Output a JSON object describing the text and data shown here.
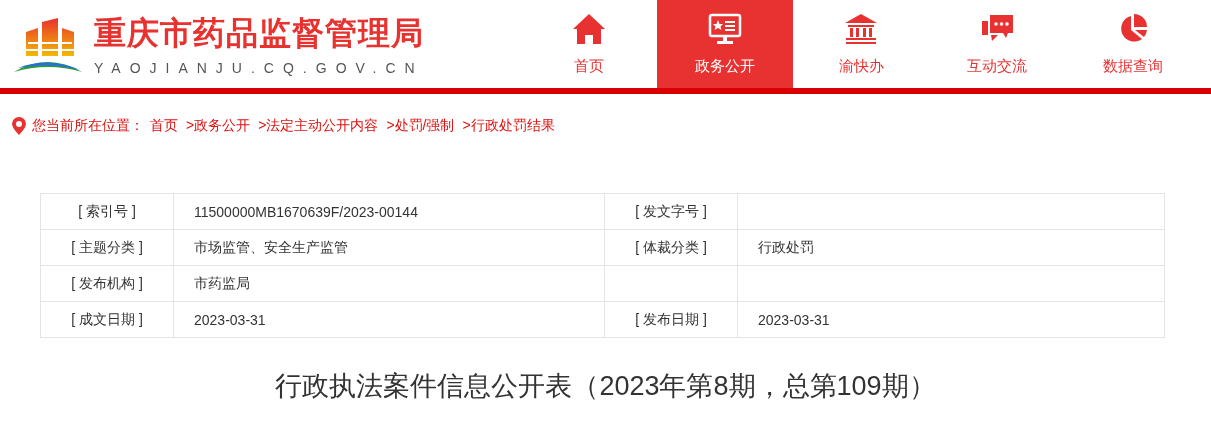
{
  "site": {
    "title": "重庆市药品监督管理局",
    "domain": "YAOJIANJU.CQ.GOV.CN"
  },
  "nav": [
    {
      "label": "首页",
      "kind": "home",
      "selected": false
    },
    {
      "label": "政务公开",
      "kind": "screen",
      "selected": true
    },
    {
      "label": "渝快办",
      "kind": "bank",
      "selected": false
    },
    {
      "label": "互动交流",
      "kind": "chat",
      "selected": false
    },
    {
      "label": "数据查询",
      "kind": "pie",
      "selected": false
    }
  ],
  "breadcrumb": {
    "label": "您当前所在位置：",
    "links": [
      "首页",
      ">政务公开",
      ">法定主动公开内容",
      ">处罚/强制",
      ">行政处罚结果"
    ]
  },
  "info_table": [
    {
      "label_1": "[ 索引号 ]",
      "value_1": "11500000MB1670639F/2023-00144",
      "label_2": "[ 发文字号 ]"
    },
    {
      "label_1": "[ 主题分类 ]",
      "value_1": "市场监管、安全生产监管",
      "label_2": "[ 体裁分类 ]",
      "value_2": "行政处罚"
    },
    {
      "label_1": "[ 发布机构 ]",
      "value_1": "市药监局"
    },
    {
      "label_1": "[ 成文日期 ]",
      "value_1": "2023-03-31",
      "label_2": "[ 发布日期 ]",
      "value_2": "2023-03-31"
    }
  ],
  "article": {
    "title": "行政执法案件信息公开表（2023年第8期，总第109期）"
  }
}
